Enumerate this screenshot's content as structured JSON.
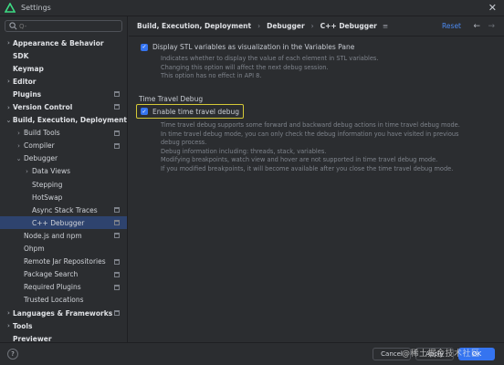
{
  "window": {
    "title": "Settings",
    "close_glyph": "✕"
  },
  "search": {
    "placeholder": "Q-"
  },
  "sidebar": {
    "items": [
      {
        "label": "Appearance & Behavior",
        "level": 0,
        "bold": true,
        "chevron": "›",
        "icon": false,
        "selected": false
      },
      {
        "label": "SDK",
        "level": 0,
        "bold": true,
        "chevron": "",
        "icon": false,
        "selected": false
      },
      {
        "label": "Keymap",
        "level": 0,
        "bold": true,
        "chevron": "",
        "icon": false,
        "selected": false
      },
      {
        "label": "Editor",
        "level": 0,
        "bold": true,
        "chevron": "›",
        "icon": false,
        "selected": false
      },
      {
        "label": "Plugins",
        "level": 0,
        "bold": true,
        "chevron": "",
        "icon": true,
        "selected": false
      },
      {
        "label": "Version Control",
        "level": 0,
        "bold": true,
        "chevron": "›",
        "icon": true,
        "selected": false
      },
      {
        "label": "Build, Execution, Deployment",
        "level": 0,
        "bold": true,
        "chevron": "⌄",
        "icon": false,
        "selected": false
      },
      {
        "label": "Build Tools",
        "level": 1,
        "bold": false,
        "chevron": "›",
        "icon": true,
        "selected": false
      },
      {
        "label": "Compiler",
        "level": 1,
        "bold": false,
        "chevron": "›",
        "icon": true,
        "selected": false
      },
      {
        "label": "Debugger",
        "level": 1,
        "bold": false,
        "chevron": "⌄",
        "icon": false,
        "selected": false
      },
      {
        "label": "Data Views",
        "level": 2,
        "bold": false,
        "chevron": "›",
        "icon": false,
        "selected": false
      },
      {
        "label": "Stepping",
        "level": 2,
        "bold": false,
        "chevron": "",
        "icon": false,
        "selected": false
      },
      {
        "label": "HotSwap",
        "level": 2,
        "bold": false,
        "chevron": "",
        "icon": false,
        "selected": false
      },
      {
        "label": "Async Stack Traces",
        "level": 2,
        "bold": false,
        "chevron": "",
        "icon": true,
        "selected": false
      },
      {
        "label": "C++ Debugger",
        "level": 2,
        "bold": false,
        "chevron": "",
        "icon": true,
        "selected": true
      },
      {
        "label": "Node.js and npm",
        "level": 1,
        "bold": false,
        "chevron": "",
        "icon": true,
        "selected": false
      },
      {
        "label": "Ohpm",
        "level": 1,
        "bold": false,
        "chevron": "",
        "icon": false,
        "selected": false
      },
      {
        "label": "Remote Jar Repositories",
        "level": 1,
        "bold": false,
        "chevron": "",
        "icon": true,
        "selected": false
      },
      {
        "label": "Package Search",
        "level": 1,
        "bold": false,
        "chevron": "",
        "icon": true,
        "selected": false
      },
      {
        "label": "Required Plugins",
        "level": 1,
        "bold": false,
        "chevron": "",
        "icon": true,
        "selected": false
      },
      {
        "label": "Trusted Locations",
        "level": 1,
        "bold": false,
        "chevron": "",
        "icon": false,
        "selected": false
      },
      {
        "label": "Languages & Frameworks",
        "level": 0,
        "bold": true,
        "chevron": "›",
        "icon": true,
        "selected": false
      },
      {
        "label": "Tools",
        "level": 0,
        "bold": true,
        "chevron": "›",
        "icon": false,
        "selected": false
      },
      {
        "label": "Previewer",
        "level": 0,
        "bold": true,
        "chevron": "",
        "icon": false,
        "selected": false
      }
    ]
  },
  "breadcrumb": {
    "items": [
      "Build, Execution, Deployment",
      "Debugger",
      "C++ Debugger"
    ],
    "separator": "›",
    "reset": "Reset",
    "back_glyph": "←",
    "forward_glyph": "→",
    "pin_glyph": "≡"
  },
  "stl": {
    "checked": true,
    "label": "Display STL variables as visualization in the Variables Pane",
    "help": [
      "Indicates whether to display the value of each element in STL variables.",
      "Changing this option will affect the next debug session.",
      "This option has no effect in API 8."
    ]
  },
  "time_travel": {
    "section_title": "Time Travel Debug",
    "checked": true,
    "label": "Enable time travel debug",
    "help": [
      "Time travel debug supports some forward and backward debug actions in time travel debug mode.",
      "In time travel debug mode, you can only check the debug information you have visited in previous",
      "debug process.",
      "Debug information including: threads, stack, variables.",
      "Modifying breakpoints, watch view and hover are not supported in time travel debug mode.",
      "If you modified breakpoints, it will become available after you close the time travel debug mode."
    ]
  },
  "footer": {
    "help": "?",
    "cancel": "Cancel",
    "apply": "Apply",
    "ok": "OK"
  },
  "watermark": "@稀土掘金技术社区",
  "colors": {
    "accent": "#3574f0",
    "selection": "#2e436e",
    "highlight_box": "#d4c837",
    "link": "#4c8af0"
  }
}
